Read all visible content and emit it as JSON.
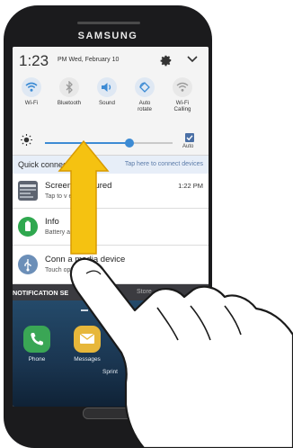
{
  "phone": {
    "brand": "SAMSUNG"
  },
  "status": {
    "time": "1:23",
    "ampm": "PM",
    "date": "Wed, February 10"
  },
  "toggles": [
    {
      "label": "Wi-Fi",
      "icon": "wifi-icon",
      "active": true
    },
    {
      "label": "Bluetooth",
      "icon": "bluetooth-icon",
      "active": false
    },
    {
      "label": "Sound",
      "icon": "sound-icon",
      "active": true
    },
    {
      "label": "Auto\nrotate",
      "icon": "auto-rotate-icon",
      "active": true
    },
    {
      "label": "Wi-Fi\nCalling",
      "icon": "wifi-calling-icon",
      "active": false
    }
  ],
  "brightness": {
    "level": 0.66,
    "auto_label": "Auto",
    "auto_checked": true
  },
  "quick_connect": {
    "title": "Quick connect",
    "hint": "Tap here to connect devices"
  },
  "notifications": [
    {
      "title": "Screens    captured",
      "subtitle": "Tap to v        enshot.",
      "time": "1:22 PM",
      "icon": "screenshot-thumbnail-icon"
    },
    {
      "title": "Info",
      "subtitle": "Battery     arged.",
      "time": "",
      "icon": "battery-icon"
    },
    {
      "title": "Conn        a media device",
      "subtitle": "Touch        options.",
      "time": "",
      "icon": "usb-icon"
    }
  ],
  "bottom_bar": {
    "left": "NOTIFICATION SE",
    "middle": "Store",
    "right": "CLE"
  },
  "home": {
    "dock": [
      {
        "label": "Phone",
        "icon": "phone-icon",
        "color": "#3aa655"
      },
      {
        "label": "Messages",
        "icon": "messages-icon",
        "color": "#e7b73a"
      },
      {
        "label": "Interne",
        "icon": "internet-icon",
        "color": "#6b5fc7"
      }
    ],
    "carrier": "Sprint"
  },
  "colors": {
    "accent": "#3d8bd4",
    "arrow": "#f5c211",
    "arrow_outline": "#d89a00"
  }
}
